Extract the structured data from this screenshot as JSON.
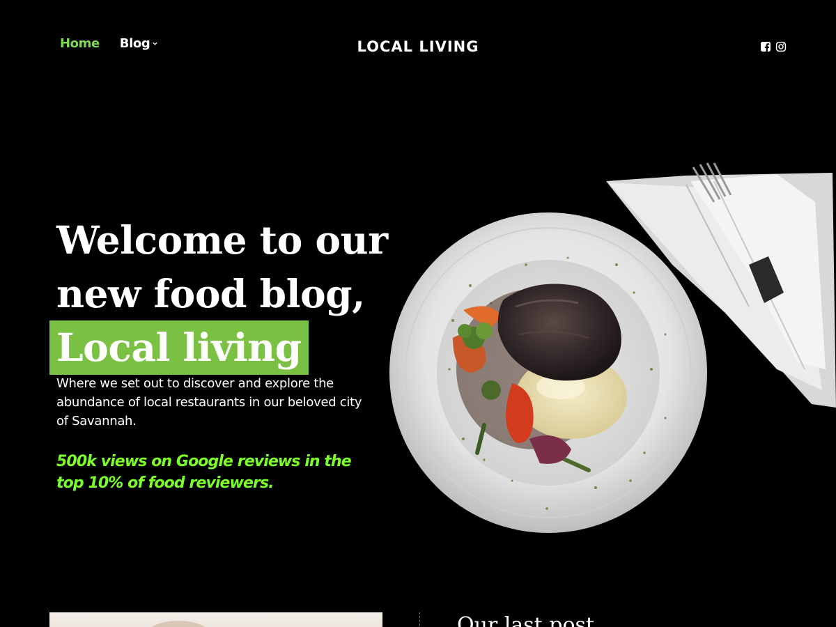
{
  "nav": {
    "home_label": "Home",
    "blog_label": "Blog"
  },
  "site": {
    "title": "LOCAL LIVING"
  },
  "social": {
    "icons": [
      "facebook-icon",
      "instagram-icon"
    ]
  },
  "hero": {
    "heading_line1": "Welcome to our",
    "heading_line2": "new food blog,",
    "heading_highlight": "Local living",
    "description": "Where we set out to discover and explore the abundance of local restaurants in our beloved city of Savannah.",
    "stat": "500k views on Google reviews in the top 10% of food reviewers."
  },
  "latest": {
    "title": "Our last post"
  },
  "colors": {
    "background": "#000000",
    "accent": "#7ac143",
    "nav_active": "#7ed957",
    "stat_text": "#7cff2b"
  }
}
